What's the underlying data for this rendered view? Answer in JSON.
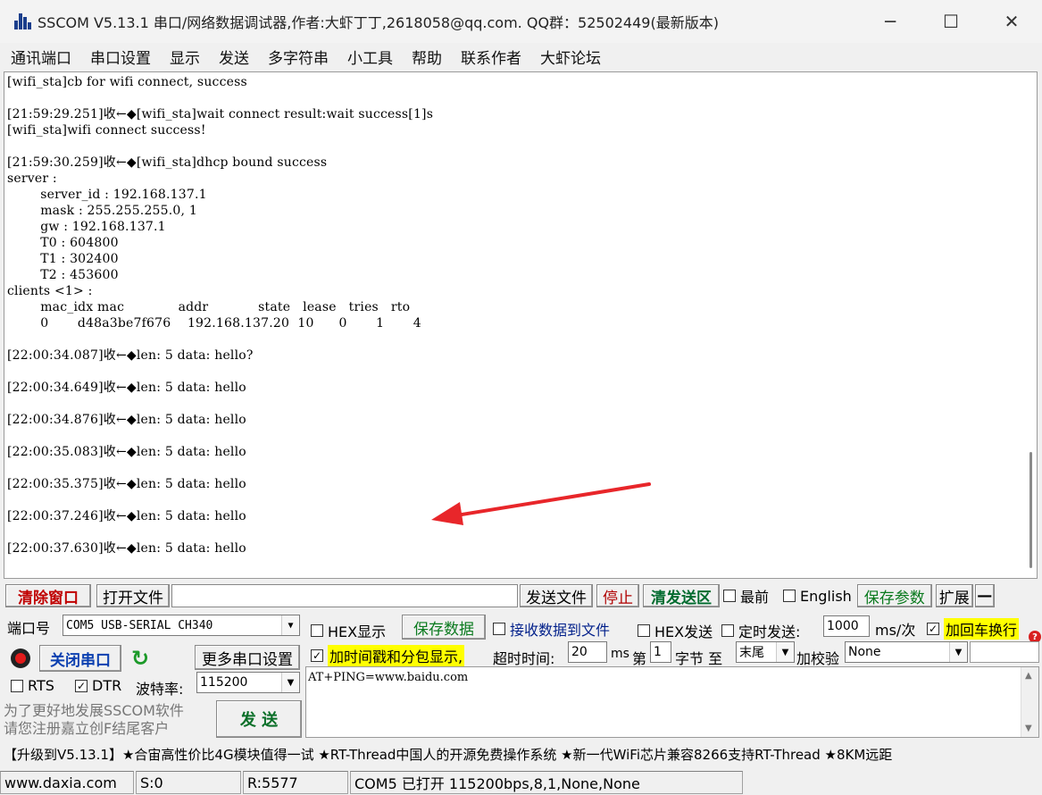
{
  "window": {
    "title": "SSCOM V5.13.1 串口/网络数据调试器,作者:大虾丁丁,2618058@qq.com. QQ群：52502449(最新版本)"
  },
  "menu": [
    "通讯端口",
    "串口设置",
    "显示",
    "发送",
    "多字符串",
    "小工具",
    "帮助",
    "联系作者",
    "大虾论坛"
  ],
  "receive": {
    "lines": [
      "[wifi_sta]cb for wifi connect, success",
      "",
      "[21:59:29.251]收←◆[wifi_sta]wait connect result:wait success[1]s",
      "[wifi_sta]wifi connect success!",
      "",
      "[21:59:30.259]收←◆[wifi_sta]dhcp bound success",
      "server :",
      "        server_id : 192.168.137.1",
      "        mask : 255.255.255.0, 1",
      "        gw : 192.168.137.1",
      "        T0 : 604800",
      "        T1 : 302400",
      "        T2 : 453600",
      "clients <1> :",
      "        mac_idx mac             addr            state   lease   tries   rto",
      "        0       d48a3be7f676    192.168.137.20  10      0       1       4",
      "",
      "[22:00:34.087]收←◆len: 5 data: hello?",
      "",
      "[22:00:34.649]收←◆len: 5 data: hello",
      "",
      "[22:00:34.876]收←◆len: 5 data: hello",
      "",
      "[22:00:35.083]收←◆len: 5 data: hello",
      "",
      "[22:00:35.375]收←◆len: 5 data: hello",
      "",
      "[22:00:37.246]收←◆len: 5 data: hello",
      "",
      "[22:00:37.630]收←◆len: 5 data: hello"
    ]
  },
  "toolbar": {
    "clear_window": "清除窗口",
    "open_file": "打开文件",
    "send_file": "发送文件",
    "stop": "停止",
    "clear_send": "清发送区",
    "topmost": "最前",
    "english": "English",
    "save_params": "保存参数",
    "expand": "扩展",
    "collapse": "—"
  },
  "port": {
    "port_label": "端口号",
    "port_value": "COM5 USB-SERIAL CH340",
    "close_port": "关闭串口",
    "more_settings": "更多串口设置",
    "rts": "RTS",
    "dtr": "DTR",
    "baud_label": "波特率:",
    "baud_value": "115200",
    "promo_line1": "为了更好地发展SSCOM软件",
    "promo_line2": "请您注册嘉立创F结尾客户",
    "send_button": "发  送"
  },
  "options": {
    "hex_display": "HEX显示",
    "save_data": "保存数据",
    "recv_to_file": "接收数据到文件",
    "hex_send": "HEX发送",
    "timed_send": "定时发送:",
    "interval_value": "1000",
    "interval_unit": "ms/次",
    "add_crlf": "加回车换行",
    "timestamp": "加时间戳和分包显示,",
    "timeout_label": "超时时间:",
    "timeout_value": "20",
    "timeout_unit": "ms",
    "nth_label": "第",
    "nth_value": "1",
    "byte_label": "字节 至",
    "end_value": "末尾",
    "checksum_label": "加校验",
    "checksum_value": "None"
  },
  "send": {
    "text": "AT+PING=www.baidu.com"
  },
  "ticker": "【升级到V5.13.1】★合宙高性价比4G模块值得一试 ★RT-Thread中国人的开源免费操作系统 ★新一代WiFi芯片兼容8266支持RT-Thread ★8KM远距",
  "status": {
    "website": "www.daxia.com",
    "sent": "S:0",
    "received": "R:5577",
    "port_state": "COM5 已打开  115200bps,8,1,None,None"
  },
  "colors": {
    "arrow": "#e8262a",
    "highlight": "#ffff00"
  }
}
